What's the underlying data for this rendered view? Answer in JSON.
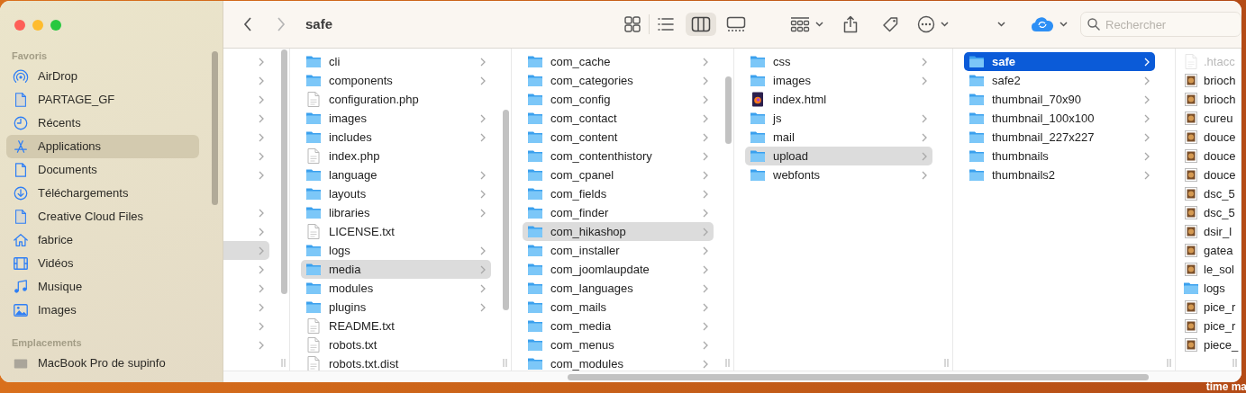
{
  "window": {
    "title": "safe"
  },
  "toolbar": {
    "back": {
      "disabled": false
    },
    "forward": {
      "disabled": true
    },
    "views": [
      {
        "kind": "icons",
        "selected": false
      },
      {
        "kind": "list",
        "selected": false
      },
      {
        "kind": "columns",
        "selected": true
      },
      {
        "kind": "gallery",
        "selected": false
      }
    ],
    "search": {
      "placeholder": "Rechercher"
    }
  },
  "sidebar": {
    "sections": [
      {
        "title": "Favoris",
        "items": [
          {
            "label": "AirDrop",
            "kind": "airdrop",
            "selected": false
          },
          {
            "label": "PARTAGE_GF",
            "kind": "file",
            "selected": false
          },
          {
            "label": "Récents",
            "kind": "recents",
            "selected": false
          },
          {
            "label": "Applications",
            "kind": "applications",
            "selected": true
          },
          {
            "label": "Documents",
            "kind": "documents",
            "selected": false
          },
          {
            "label": "Téléchargements",
            "kind": "downloads",
            "selected": false
          },
          {
            "label": "Creative Cloud Files",
            "kind": "file",
            "selected": false
          },
          {
            "label": "fabrice",
            "kind": "home",
            "selected": false
          },
          {
            "label": "Vidéos",
            "kind": "movies",
            "selected": false
          },
          {
            "label": "Musique",
            "kind": "music",
            "selected": false
          },
          {
            "label": "Images",
            "kind": "pictures",
            "selected": false
          }
        ]
      },
      {
        "title": "Emplacements",
        "items": [
          {
            "label": "MacBook Pro de supinfo",
            "kind": "computer",
            "selected": false
          }
        ]
      }
    ]
  },
  "columns": [
    {
      "active": false,
      "items": [
        {
          "kind": "folder",
          "selected": false
        },
        {
          "kind": "folder",
          "selected": false
        },
        {
          "kind": "folder",
          "selected": false
        },
        {
          "kind": "folder",
          "selected": false
        },
        {
          "kind": "folder",
          "selected": false
        },
        {
          "kind": "folder",
          "selected": false
        },
        {
          "kind": "folder",
          "selected": false
        },
        {
          "kind": "file",
          "selected": false
        },
        {
          "kind": "folder",
          "selected": false
        },
        {
          "kind": "folder",
          "selected": false
        },
        {
          "kind": "folder",
          "selected": true
        },
        {
          "kind": "folder",
          "selected": false
        },
        {
          "kind": "folder",
          "selected": false
        },
        {
          "kind": "folder",
          "selected": false
        },
        {
          "kind": "folder",
          "selected": false
        },
        {
          "kind": "folder",
          "selected": false
        }
      ]
    },
    {
      "active": false,
      "items": [
        {
          "name": "cli",
          "kind": "folder",
          "selected": false
        },
        {
          "name": "components",
          "kind": "folder",
          "selected": false
        },
        {
          "name": "configuration.php",
          "kind": "file",
          "selected": false
        },
        {
          "name": "images",
          "kind": "folder",
          "selected": false
        },
        {
          "name": "includes",
          "kind": "folder",
          "selected": false
        },
        {
          "name": "index.php",
          "kind": "file",
          "selected": false
        },
        {
          "name": "language",
          "kind": "folder",
          "selected": false
        },
        {
          "name": "layouts",
          "kind": "folder",
          "selected": false
        },
        {
          "name": "libraries",
          "kind": "folder",
          "selected": false
        },
        {
          "name": "LICENSE.txt",
          "kind": "file",
          "selected": false
        },
        {
          "name": "logs",
          "kind": "folder",
          "selected": false
        },
        {
          "name": "media",
          "kind": "folder",
          "selected": true
        },
        {
          "name": "modules",
          "kind": "folder",
          "selected": false
        },
        {
          "name": "plugins",
          "kind": "folder",
          "selected": false
        },
        {
          "name": "README.txt",
          "kind": "file",
          "selected": false
        },
        {
          "name": "robots.txt",
          "kind": "file",
          "selected": false
        },
        {
          "name": "robots.txt.dist",
          "kind": "file",
          "selected": false
        }
      ]
    },
    {
      "active": false,
      "items": [
        {
          "name": "com_cache",
          "kind": "folder",
          "selected": false
        },
        {
          "name": "com_categories",
          "kind": "folder",
          "selected": false
        },
        {
          "name": "com_config",
          "kind": "folder",
          "selected": false
        },
        {
          "name": "com_contact",
          "kind": "folder",
          "selected": false
        },
        {
          "name": "com_content",
          "kind": "folder",
          "selected": false
        },
        {
          "name": "com_contenthistory",
          "kind": "folder",
          "selected": false
        },
        {
          "name": "com_cpanel",
          "kind": "folder",
          "selected": false
        },
        {
          "name": "com_fields",
          "kind": "folder",
          "selected": false
        },
        {
          "name": "com_finder",
          "kind": "folder",
          "selected": false
        },
        {
          "name": "com_hikashop",
          "kind": "folder",
          "selected": true
        },
        {
          "name": "com_installer",
          "kind": "folder",
          "selected": false
        },
        {
          "name": "com_joomlaupdate",
          "kind": "folder",
          "selected": false
        },
        {
          "name": "com_languages",
          "kind": "folder",
          "selected": false
        },
        {
          "name": "com_mails",
          "kind": "folder",
          "selected": false
        },
        {
          "name": "com_media",
          "kind": "folder",
          "selected": false
        },
        {
          "name": "com_menus",
          "kind": "folder",
          "selected": false
        },
        {
          "name": "com_modules",
          "kind": "folder",
          "selected": false
        }
      ]
    },
    {
      "active": false,
      "items": [
        {
          "name": "css",
          "kind": "folder",
          "selected": false
        },
        {
          "name": "images",
          "kind": "folder",
          "selected": false
        },
        {
          "name": "index.html",
          "kind": "html",
          "selected": false
        },
        {
          "name": "js",
          "kind": "folder",
          "selected": false
        },
        {
          "name": "mail",
          "kind": "folder",
          "selected": false
        },
        {
          "name": "upload",
          "kind": "folder",
          "selected": true
        },
        {
          "name": "webfonts",
          "kind": "folder",
          "selected": false
        }
      ]
    },
    {
      "active": true,
      "items": [
        {
          "name": "safe",
          "kind": "folder",
          "selected": true
        },
        {
          "name": "safe2",
          "kind": "folder",
          "selected": false
        },
        {
          "name": "thumbnail_70x90",
          "kind": "folder",
          "selected": false
        },
        {
          "name": "thumbnail_100x100",
          "kind": "folder",
          "selected": false
        },
        {
          "name": "thumbnail_227x227",
          "kind": "folder",
          "selected": false
        },
        {
          "name": "thumbnails",
          "kind": "folder",
          "selected": false
        },
        {
          "name": "thumbnails2",
          "kind": "folder",
          "selected": false
        }
      ]
    },
    {
      "active": false,
      "items": [
        {
          "name": ".htacc",
          "kind": "file",
          "selected": false,
          "dimmed": true
        },
        {
          "name": "brioch",
          "kind": "image",
          "selected": false,
          "dimmed": false
        },
        {
          "name": "brioch",
          "kind": "image",
          "selected": false,
          "dimmed": false
        },
        {
          "name": "cureu",
          "kind": "image",
          "selected": false,
          "dimmed": false
        },
        {
          "name": "douce",
          "kind": "image",
          "selected": false,
          "dimmed": false
        },
        {
          "name": "douce",
          "kind": "image",
          "selected": false,
          "dimmed": false
        },
        {
          "name": "douce",
          "kind": "image",
          "selected": false,
          "dimmed": false
        },
        {
          "name": "dsc_5",
          "kind": "image",
          "selected": false,
          "dimmed": false
        },
        {
          "name": "dsc_5",
          "kind": "image",
          "selected": false,
          "dimmed": false
        },
        {
          "name": "dsir_l",
          "kind": "image",
          "selected": false,
          "dimmed": false
        },
        {
          "name": "gatea",
          "kind": "image",
          "selected": false,
          "dimmed": false
        },
        {
          "name": "le_sol",
          "kind": "image",
          "selected": false,
          "dimmed": false
        },
        {
          "name": "logs",
          "kind": "folder",
          "selected": false,
          "dimmed": false
        },
        {
          "name": "pice_r",
          "kind": "image",
          "selected": false,
          "dimmed": false
        },
        {
          "name": "pice_r",
          "kind": "image",
          "selected": false,
          "dimmed": false
        },
        {
          "name": "piece_",
          "kind": "image",
          "selected": false,
          "dimmed": false
        }
      ]
    }
  ],
  "desktop": {
    "label": "time ma"
  }
}
